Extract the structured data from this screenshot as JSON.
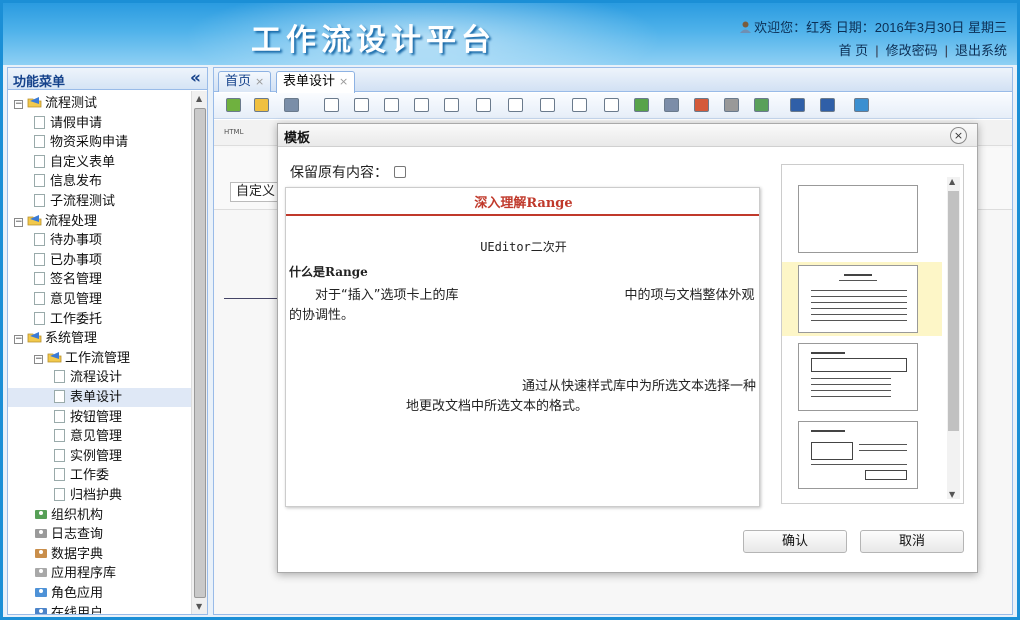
{
  "header": {
    "app_title": "工作流设计平台",
    "welcome": "欢迎您：红秀  日期：2016年3月30日 星期三",
    "links": [
      "首 页",
      "修改密码",
      "退出系统"
    ]
  },
  "sidebar": {
    "title": "功能菜单",
    "collapse_glyph": "«",
    "tree": [
      {
        "label": "流程测试",
        "level": 0,
        "toggle": "−"
      },
      {
        "label": "请假申请",
        "level": 1
      },
      {
        "label": "物资采购申请",
        "level": 1
      },
      {
        "label": "自定义表单",
        "level": 1
      },
      {
        "label": "信息发布",
        "level": 1
      },
      {
        "label": "子流程测试",
        "level": 1
      },
      {
        "label": "流程处理",
        "level": 0,
        "toggle": "−"
      },
      {
        "label": "待办事项",
        "level": 1
      },
      {
        "label": "已办事项",
        "level": 1
      },
      {
        "label": "签名管理",
        "level": 1
      },
      {
        "label": "意见管理",
        "level": 1
      },
      {
        "label": "工作委托",
        "level": 1
      },
      {
        "label": "系统管理",
        "level": 0,
        "toggle": "−"
      },
      {
        "label": "工作流管理",
        "level": 1,
        "toggle": "−"
      },
      {
        "label": "流程设计",
        "level": 2
      },
      {
        "label": "表单设计",
        "level": 2,
        "selected": true
      },
      {
        "label": "按钮管理",
        "level": 2
      },
      {
        "label": "意见管理",
        "level": 2
      },
      {
        "label": "实例管理",
        "level": 2
      },
      {
        "label": "工作委",
        "level": 2
      },
      {
        "label": "归档护典",
        "level": 2
      },
      {
        "label": "组织机构",
        "level": 1,
        "icon": "org-icon"
      },
      {
        "label": "日志查询",
        "level": 1,
        "icon": "log-icon"
      },
      {
        "label": "数据字典",
        "level": 1,
        "icon": "dictionary-icon"
      },
      {
        "label": "应用程序库",
        "level": 1,
        "icon": "app-library-icon"
      },
      {
        "label": "角色应用",
        "level": 1,
        "icon": "role-icon"
      },
      {
        "label": "在线用户",
        "level": 1,
        "icon": "online-user-icon"
      }
    ]
  },
  "tabs": [
    {
      "label": "首页",
      "close": "×"
    },
    {
      "label": "表单设计",
      "close": "×",
      "active": true
    }
  ],
  "editor": {
    "html_button": "HTML",
    "custom_select": "自定义"
  },
  "modal": {
    "title": "模板",
    "close_glyph": "×",
    "keep_content_label": "保留原有内容：",
    "keep_content_checked": false,
    "preview": {
      "title": "深入理解Range",
      "subtitle": "UEditor二次开",
      "heading": "什么是Range",
      "para1_start": "对于“插入”选项卡上的库",
      "para1_end": "中的项与文档整体外观的协调性。",
      "para2_line1": "通过从快速样式库中为所选文本选择一种",
      "para2_line2": "地更改文档中所选文本的格式。"
    },
    "selected_template_index": 1,
    "confirm_label": "确认",
    "cancel_label": "取消"
  },
  "colors": {
    "header_blue": "#2a9be0",
    "panel_border": "#99bbe8",
    "preview_red": "#c0392b",
    "template_selected": "#fdf6c7"
  }
}
